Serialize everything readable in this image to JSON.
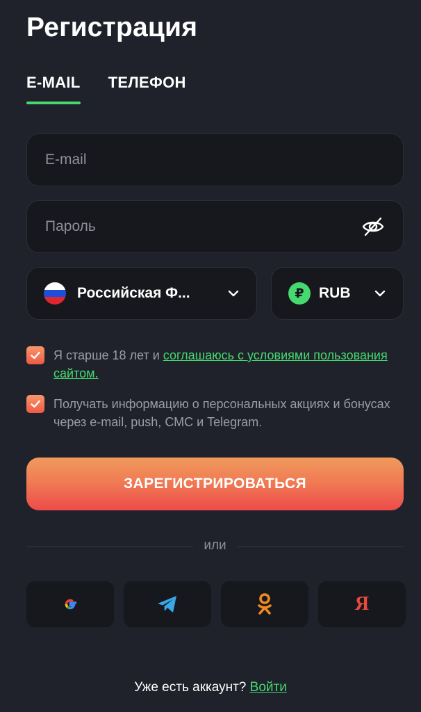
{
  "page": {
    "title": "Регистрация"
  },
  "tabs": [
    {
      "label": "E-MAIL",
      "active": true
    },
    {
      "label": "ТЕЛЕФОН",
      "active": false
    }
  ],
  "form": {
    "email": {
      "placeholder": "E-mail",
      "value": ""
    },
    "password": {
      "placeholder": "Пароль",
      "value": "",
      "toggle_icon": "eye-off-icon"
    },
    "country": {
      "label": "Российская Ф...",
      "icon": "russia-flag-icon"
    },
    "currency": {
      "label": "RUB",
      "icon": "ruble-icon",
      "symbol": "₽"
    }
  },
  "checkboxes": {
    "terms": {
      "checked": true,
      "text": "Я старше 18 лет и ",
      "link": "соглашаюсь с условиями пользования сайтом."
    },
    "promo": {
      "checked": true,
      "text": "Получать информацию о персональных акциях и бонусах через e-mail, push, СМС и Telegram."
    }
  },
  "register_button": {
    "label": "ЗАРЕГИСТРИРОВАТЬСЯ"
  },
  "divider": {
    "label": "или"
  },
  "socials": [
    {
      "icon": "google-icon",
      "glyph": "G"
    },
    {
      "icon": "telegram-icon"
    },
    {
      "icon": "odnoklassniki-icon"
    },
    {
      "icon": "yandex-icon",
      "glyph": "Я"
    }
  ],
  "footer": {
    "text": "Уже есть аккаунт? ",
    "link": "Войти"
  },
  "colors": {
    "background": "#1f222b",
    "field_bg": "#16181d",
    "accent_green": "#45d96f",
    "button_orange": "#f09a5d",
    "button_red": "#ee4b4a"
  }
}
